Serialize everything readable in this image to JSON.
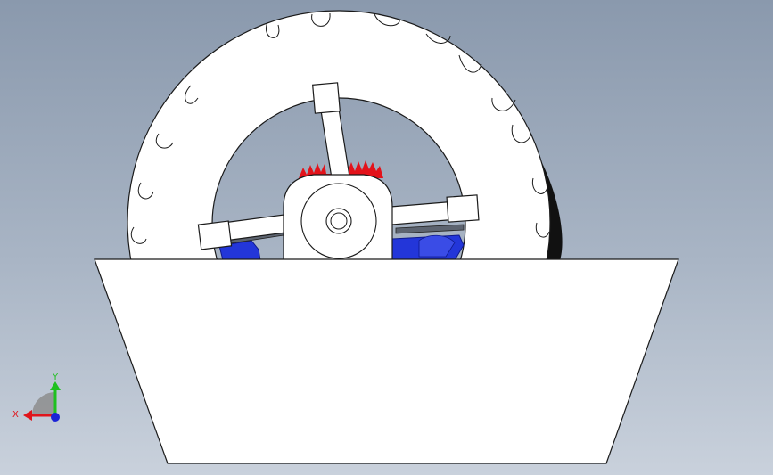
{
  "triad": {
    "x_label": "X",
    "y_label": "Y",
    "x_color": "#e0141b",
    "y_color": "#1fc01f",
    "z_color": "#1a22d6"
  },
  "colors": {
    "background_top": "#8a99ad",
    "background_bottom": "#c9d1dc",
    "part_fill": "#ffffff",
    "outline": "#1a1a1a",
    "gear": "#e3121a",
    "motor_housing": "#2336d9"
  },
  "icons": [
    "coordinate-triad-icon"
  ]
}
